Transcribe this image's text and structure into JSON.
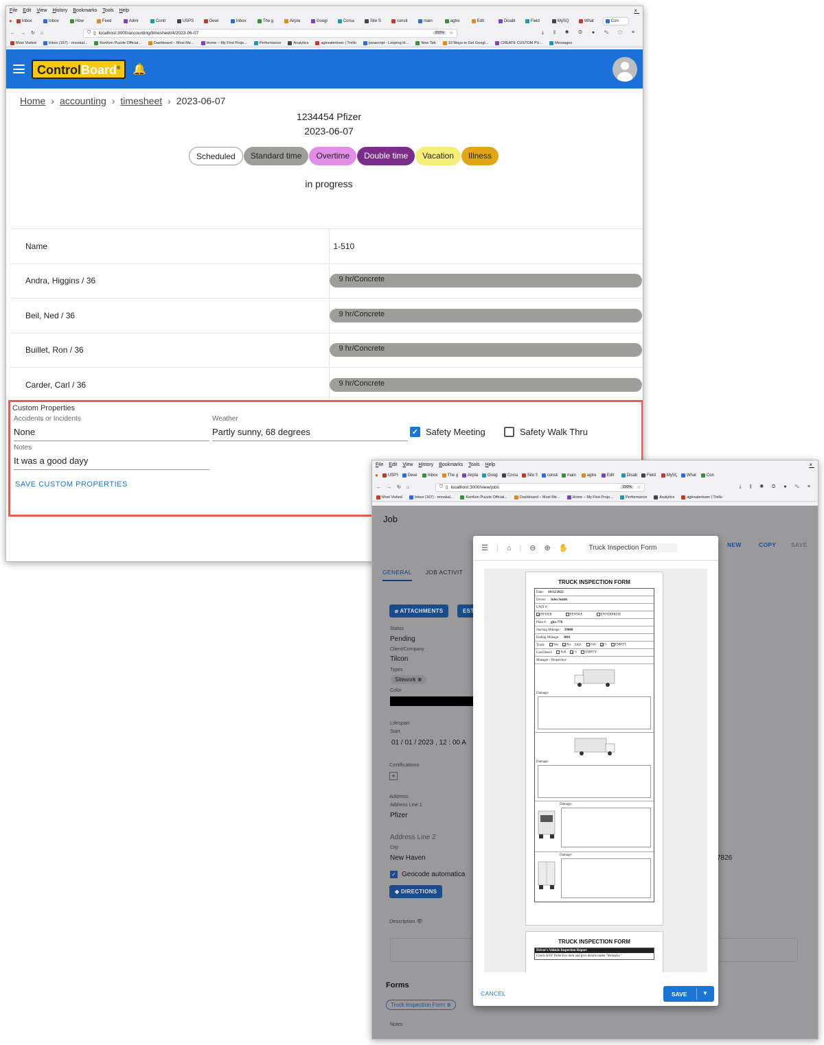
{
  "win1": {
    "menu": [
      "File",
      "Edit",
      "View",
      "History",
      "Bookmarks",
      "Tools",
      "Help"
    ],
    "tabs": [
      "Inbox",
      "Inbox",
      "How",
      "Feed",
      "Admi",
      "Contr",
      "USPS",
      "Dewi",
      "Inbox",
      "The g",
      "Airpla",
      "Googl",
      "Corsa",
      "Site S",
      "consti",
      "main",
      "agtre",
      "Edit",
      "Disabl",
      "Field",
      "MySQ",
      "What",
      "Con"
    ],
    "url": "localhost:3000/accounting/timesheet/4/2023-06-07",
    "zoom": "200%",
    "bookmarks": [
      "Most Visited",
      "Inbox (167) - rmoskal...",
      "KenKen Puzzle Official...",
      "Dashboard – Most Me...",
      "Home – My First Proje...",
      "Performance",
      "Analytics",
      "agtreatertown | Trello",
      "javascript - Looping th...",
      "New Tab",
      "10 Ways to Get Googl...",
      "CREATE CUSTOM PU...",
      "Messages"
    ]
  },
  "app": {
    "logo_a": "Control",
    "logo_b": "Board",
    "logo_reg": "®",
    "breadcrumb": {
      "home": "Home",
      "accounting": "accounting",
      "timesheet": "timesheet",
      "current": "2023-06-07"
    },
    "job_line": "1234454 Pfizer",
    "date": "2023-06-07",
    "status": "in progress",
    "legend": [
      {
        "label": "Scheduled",
        "color": "#ffffff"
      },
      {
        "label": "Standard time",
        "color": "#9e9e9a"
      },
      {
        "label": "Overtime",
        "color": "#e38ee6"
      },
      {
        "label": "Double time",
        "color": "#7b2d8b"
      },
      {
        "label": "Vacation",
        "color": "#f5ef7a"
      },
      {
        "label": "Illness",
        "color": "#e0a615"
      }
    ],
    "table": {
      "col_name": "Name",
      "col_job": "1-510",
      "rows": [
        {
          "name": "Andra, Higgins / 36",
          "entry": "9 hr/Concrete"
        },
        {
          "name": "Beil, Ned / 36",
          "entry": "9 hr/Concrete"
        },
        {
          "name": "Buillet, Ron / 36",
          "entry": "9 hr/Concrete"
        },
        {
          "name": "Carder, Carl / 36",
          "entry": "9 hr/Concrete"
        }
      ]
    },
    "custom": {
      "title": "Custom Properties",
      "accidents_label": "Accidents or Incidents",
      "accidents_value": "None",
      "weather_label": "Weather",
      "weather_value": "Partly sunny, 68 degrees",
      "safety_meeting": "Safety Meeting",
      "safety_walk": "Safety Walk Thru",
      "notes_label": "Notes",
      "notes_value": "It was a good dayy",
      "save": "SAVE CUSTOM PROPERTIES"
    }
  },
  "win2": {
    "menu": [
      "File",
      "Edit",
      "View",
      "History",
      "Bookmarks",
      "Tools",
      "Help"
    ],
    "url": "localhost:3000/view/jobs",
    "zoom": "150%",
    "bookmarks": [
      "Most Visited",
      "Inbox (167) - rmoskal...",
      "KenKen Puzzle Official...",
      "Dashboard – Most Me...",
      "Home – My First Proje...",
      "Performance",
      "Analytics",
      "agtreatertown | Trello"
    ],
    "job": "Job",
    "new": "NEW",
    "copy": "COPY",
    "save_top": "SAVE",
    "tab_general": "GENERAL",
    "tab_activity": "JOB ACTIVIT",
    "attachments": "ATTACHMENTS",
    "est": "EST",
    "status_label": "Status",
    "status_value": "Pending",
    "client_label": "Client/Company",
    "client_value": "Tilcon",
    "types_label": "Types",
    "type_chip": "Sitework",
    "color_label": "Color",
    "lifespan": "Lifespan",
    "start_label": "Start",
    "start_value": "01 / 01 / 2023 ,  12 : 00   A",
    "certs": "Certifications",
    "address": "Address",
    "addr1_label": "Address Line 1",
    "addr1_value": "Pfizer",
    "addr2_label": "Address Line 2",
    "city_label": "City",
    "city_value": "New Haven",
    "zip_fragment": "7826",
    "geocode": "Geocode automatica",
    "directions": "DIRECTIONS",
    "description": "Description",
    "forms": "Forms",
    "form_chip": "Truck Inspection Form",
    "notes": "Notes"
  },
  "dialog": {
    "pdf_title": "Truck Inspection Form",
    "form_title": "TRUCK INSPECTION FORM",
    "date_label": "Date:",
    "date_value": "10/12/2022",
    "driver_label": "Driver:",
    "driver_value": "John Smith",
    "unit_label": "UNIT #:",
    "ryder": "RYDER",
    "penske": "PENSKE",
    "enterprise": "ENTERPRISE",
    "plate_label": "Plate #:",
    "plate_value": "gba-778",
    "start_mileage_label": "Starting Mileage:",
    "start_mileage_value": "39000",
    "end_mileage_label": "Ending Mileage:",
    "end_mileage_value": "3801",
    "trash": "Trash:",
    "yes": "Yes",
    "no": "No",
    "def": "DEF:",
    "full": "Full",
    "half": "½",
    "empty": "EMPTY",
    "gas": "Gas/Diesel:",
    "manager": "Manager / Dispatcher:",
    "damage": "Damage:",
    "report_header": "Driver's Vehicle Inspection Report",
    "report_note": "Check ANY Defective item and give details under \"Remarks.\"",
    "cancel": "CANCEL",
    "save": "SAVE"
  }
}
